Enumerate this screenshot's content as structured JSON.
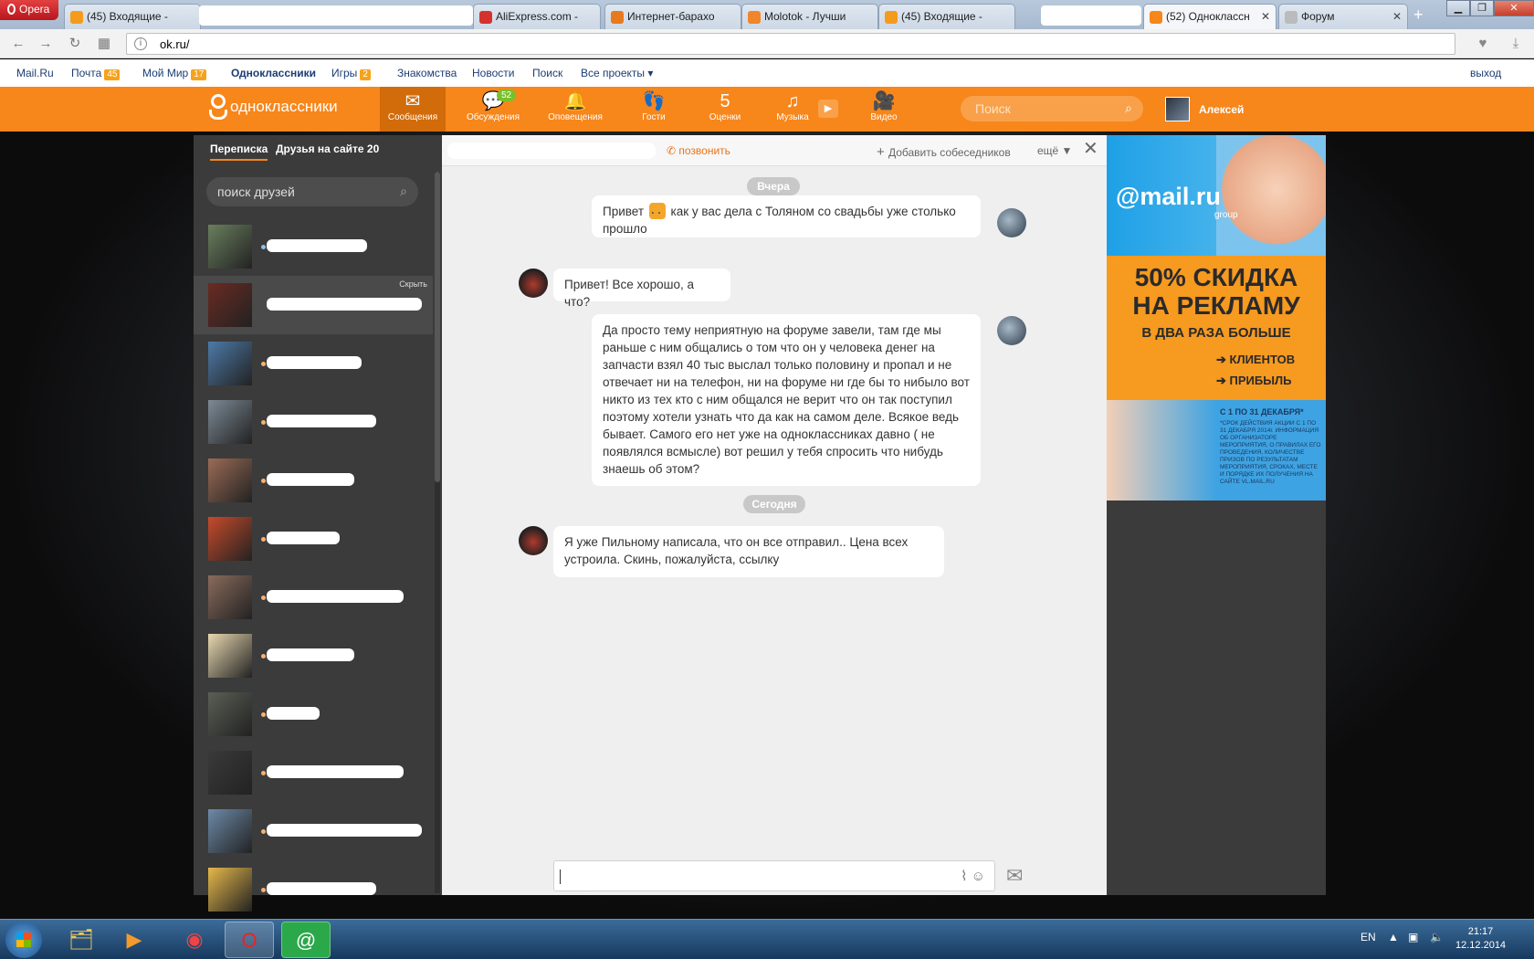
{
  "browser": {
    "menu_label": "Opera",
    "tabs": [
      {
        "title": "(45) Входящие - "
      },
      {
        "title": "AliExpress.com - "
      },
      {
        "title": "Интернет-барахо"
      },
      {
        "title": "Molotok - Лучши"
      },
      {
        "title": "(45) Входящие - "
      },
      {
        "title": "(52) Одноклассн"
      },
      {
        "title": "Форум"
      }
    ],
    "url": "ok.ru/",
    "window_controls": {
      "minimize": "▁",
      "restore": "❐",
      "close": "✕"
    }
  },
  "mailru_nav": {
    "items": [
      {
        "label": "Mail.Ru"
      },
      {
        "label": "Почта",
        "badge": "45"
      },
      {
        "label": "Мой Мир",
        "badge": "17"
      },
      {
        "label": "Одноклассники"
      },
      {
        "label": "Игры",
        "badge": "2"
      },
      {
        "label": "Знакомства"
      },
      {
        "label": "Новости"
      },
      {
        "label": "Поиск"
      },
      {
        "label": "Все проекты ▾"
      }
    ],
    "logout": "выход"
  },
  "ok_header": {
    "logo_text": "одноклассники",
    "nav": [
      {
        "label": "Сообщения",
        "icon": "✉"
      },
      {
        "label": "Обсуждения",
        "icon": "💬",
        "badge": "52"
      },
      {
        "label": "Оповещения",
        "icon": "🔔"
      },
      {
        "label": "Гости",
        "icon": "👣"
      },
      {
        "label": "Оценки",
        "icon": "5"
      },
      {
        "label": "Музыка",
        "icon": "♫"
      },
      {
        "label": "Видео",
        "icon": "🎥"
      }
    ],
    "search_placeholder": "Поиск",
    "user_name": "Алексей"
  },
  "sidebar": {
    "tab_messages": "Переписка",
    "tab_friends": "Друзья на сайте 20",
    "search_placeholder": "поиск друзей",
    "hide_label": "Скрыть",
    "contacts": [
      {
        "name": "",
        "photo": "#6a7f5e"
      },
      {
        "name": "",
        "photo": "#6b2a22"
      },
      {
        "name": "",
        "photo": "#4d7aa8"
      },
      {
        "name": "",
        "photo": "#7d8a96"
      },
      {
        "name": "",
        "photo": "#9b6b55"
      },
      {
        "name": "",
        "photo": "#c74a2a"
      },
      {
        "name": "",
        "photo": "#8a6b5c"
      },
      {
        "name": "",
        "photo": "#e8d8b0"
      },
      {
        "name": "",
        "photo": "#5a5f55"
      },
      {
        "name": "",
        "photo": "#3a3a3a"
      },
      {
        "name": "",
        "photo": "#6d8aa8"
      },
      {
        "name": "",
        "photo": "#e6b84a"
      }
    ]
  },
  "chat": {
    "call_label": "позвонить",
    "add_label": "Добавить собеседников",
    "more_label": "ещё ▼",
    "day_yesterday": "Вчера",
    "day_today": "Сегодня",
    "messages": [
      {
        "text_a": "Привет ",
        "text_b": " как у вас дела с Толяном со свадьбы уже столько прошло"
      },
      {
        "text": "Привет! Все хорошо, а что?"
      },
      {
        "text": "Да просто тему неприятную на форуме завели, там где мы раньше с ним общались о том что  он у человека денег на запчасти взял 40 тыс выслал только половину и пропал и не отвечает ни на телефон, ни на форуме ни где бы то нибыло вот никто из тех кто с ним общался не верит что он так поступил поэтому хотели узнать что да как на самом деле. Всякое ведь бывает. Самого его нет уже на одноклассниках давно ( не появлялся всмысле) вот решил у тебя спросить что нибудь знаешь об этом?"
      },
      {
        "text": "Я уже Пильному написала, что он все отправил.. Цена всех устроила. Скинь, пожалуйста, ссылку"
      }
    ]
  },
  "ad": {
    "brand": "@mail.ru",
    "group": "group",
    "headline_1": "50% СКИДКА",
    "headline_2": "НА РЕКЛАМУ",
    "subline": "В ДВА РАЗА БОЛЬШЕ",
    "bullet_1": "КЛИЕНТОВ",
    "bullet_2": "ПРИБЫЛЬ",
    "date": "С 1 ПО 31 ДЕКАБРЯ*",
    "fine_print": "*СРОК ДЕЙСТВИЯ АКЦИИ С 1 ПО 31 ДЕКАБРЯ 2014г. ИНФОРМАЦИЯ ОБ ОРГАНИЗАТОРЕ МЕРОПРИЯТИЯ, О ПРАВИЛАХ ЕГО ПРОВЕДЕНИЯ, КОЛИЧЕСТВЕ ПРИЗОВ ПО РЕЗУЛЬТАТАМ МЕРОПРИЯТИЯ, СРОКАХ, МЕСТЕ И ПОРЯДКЕ ИХ ПОЛУЧЕНИЯ НА САЙТЕ VL.MAIL.RU"
  },
  "taskbar": {
    "lang": "EN",
    "time": "21:17",
    "date": "12.12.2014"
  }
}
